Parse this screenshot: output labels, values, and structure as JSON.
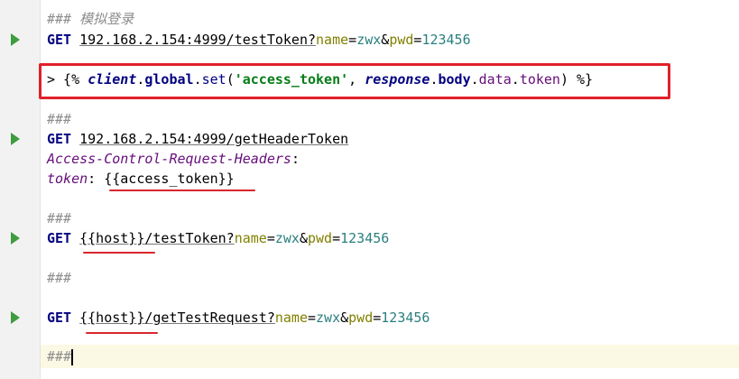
{
  "comments": {
    "c1": "### 模拟登录",
    "c2": "###",
    "c3": "###",
    "c4": "###",
    "c5": "###"
  },
  "req1": {
    "method": "GET",
    "url": "192.168.2.154:4999/testToken?",
    "p1_name": "name",
    "eq1": "=",
    "p1_val": "zwx",
    "amp": "&",
    "p2_name": "pwd",
    "eq2": "=",
    "p2_val": "123456"
  },
  "script": {
    "prefix": "> {% ",
    "client": "client",
    "dot1": ".",
    "global": "global",
    "dot2": ".",
    "set": "set",
    "paren": "(",
    "key": "'access_token'",
    "comma": ", ",
    "response": "response",
    "dot3": ".",
    "body": "body",
    "dot4": ".",
    "data": "data",
    "dot5": ".",
    "token": "token",
    "close": ") ",
    "suffix": "%}"
  },
  "req2": {
    "method": "GET",
    "url": "192.168.2.154:4999/getHeaderToken",
    "header1": "Access-Control-Request-Headers",
    "colon1": ":",
    "header2": "token",
    "colon2": ": ",
    "header2_val": "{{access_token}}"
  },
  "req3": {
    "method": "GET",
    "host": "{{host}}",
    "path": "/testToken?",
    "p1_name": "name",
    "eq1": "=",
    "p1_val": "zwx",
    "amp": "&",
    "p2_name": "pwd",
    "eq2": "=",
    "p2_val": "123456"
  },
  "req4": {
    "method": "GET",
    "host": "{{host}}",
    "path": "/getTestRequest?",
    "p1_name": "name",
    "eq1": "=",
    "p1_val": "zwx",
    "amp": "&",
    "p2_name": "pwd",
    "eq2": "=",
    "p2_val": "123456"
  },
  "colors": {
    "highlight_box": "#e0202a",
    "annotation_underline": "#d9262d",
    "run_icon": "#3f9c3f"
  },
  "icons": [
    "run-request-icon"
  ]
}
